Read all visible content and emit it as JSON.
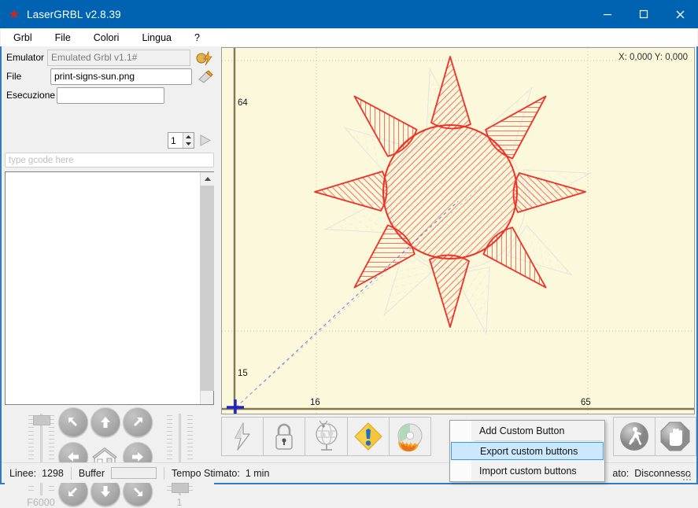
{
  "window": {
    "title": "LaserGRBL v2.8.39",
    "app_icon": "laser-star-icon",
    "minimize": "minimize-icon",
    "maximize": "maximize-icon",
    "close": "close-icon"
  },
  "menubar": {
    "items": [
      {
        "label": "Grbl"
      },
      {
        "label": "File"
      },
      {
        "label": "Colori"
      },
      {
        "label": "Lingua"
      },
      {
        "label": "?"
      }
    ]
  },
  "connection": {
    "emulator_label": "Emulator",
    "emulator_value": "Emulated Grbl v1.1#",
    "connect_icon": "connect-plug-icon",
    "file_label": "File",
    "file_value": "print-signs-sun.png",
    "open_file_icon": "open-file-pencil-icon",
    "execution_label": "Esecuzione",
    "execution_value": "",
    "repeat_value": "1",
    "run_icon": "play-triangle-icon"
  },
  "gcode": {
    "input_placeholder": "type gcode here",
    "log_lines": []
  },
  "jog": {
    "power_value": "F6000",
    "step_value": "1",
    "buttons": [
      {
        "name": "jog-up-left",
        "dir": "up-left"
      },
      {
        "name": "jog-up",
        "dir": "up"
      },
      {
        "name": "jog-up-right",
        "dir": "up-right"
      },
      {
        "name": "jog-left",
        "dir": "left"
      },
      {
        "name": "jog-home",
        "dir": "home"
      },
      {
        "name": "jog-right",
        "dir": "right"
      },
      {
        "name": "jog-down-left",
        "dir": "down-left"
      },
      {
        "name": "jog-down",
        "dir": "down"
      },
      {
        "name": "jog-down-right",
        "dir": "down-right"
      }
    ]
  },
  "preview": {
    "coordinates": "X: 0,000 Y: 0,000",
    "axis_labels": {
      "y_top": "64",
      "y_bottom": "15",
      "x_left": "16",
      "x_right": "65"
    },
    "background_color": "#fbf8db",
    "stroke_color": "#ef3124",
    "travel_color": "#6a6ad0",
    "grid_color": "#cfcaa6",
    "artwork": "sun-8-ray-hatched"
  },
  "toolbar": {
    "left_buttons": [
      {
        "name": "unlock-lightning-button",
        "icon": "lightning-bolt-icon"
      },
      {
        "name": "lock-button",
        "icon": "padlock-icon"
      },
      {
        "name": "set-zero-globe-button",
        "icon": "globe-pin-icon"
      },
      {
        "name": "alarm-button",
        "icon": "warning-diamond-icon"
      },
      {
        "name": "burn-button",
        "icon": "burning-disc-icon"
      }
    ],
    "right_buttons": [
      {
        "name": "run-button",
        "icon": "walking-person-icon"
      },
      {
        "name": "stop-button",
        "icon": "stop-hand-icon"
      }
    ]
  },
  "context_menu": {
    "items": [
      {
        "label": "Add Custom Button",
        "selected": false
      },
      {
        "label": "Export custom buttons",
        "selected": true
      },
      {
        "label": "Import custom buttons",
        "selected": false
      }
    ],
    "highlight_color": "#cce8ff"
  },
  "statusbar": {
    "lines_label": "Linee:",
    "lines_value": "1298",
    "buffer_label": "Buffer",
    "buffer_progress": 0,
    "time_label": "Tempo Stimato:",
    "time_value": "1 min",
    "state_label": "ato:",
    "state_value": "Disconnesso"
  }
}
